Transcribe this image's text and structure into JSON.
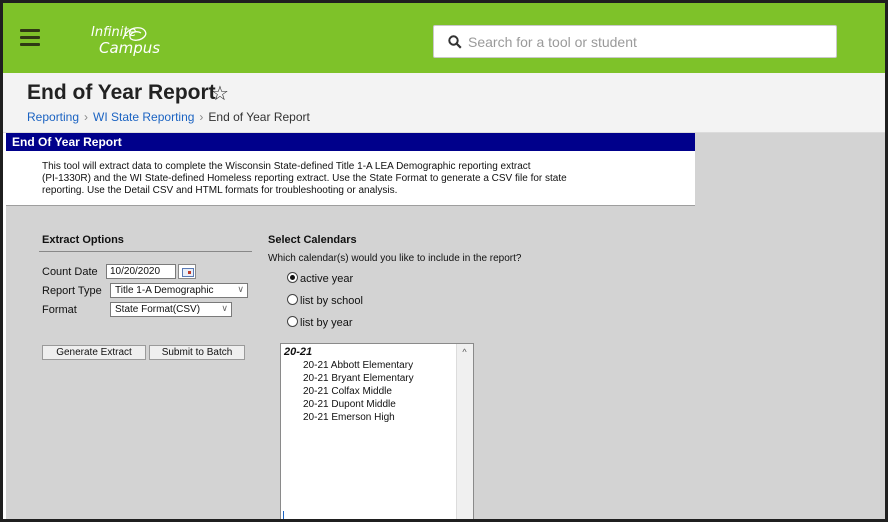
{
  "app": {
    "logo_line1": "Infinite",
    "logo_line2": "Campus",
    "search_placeholder": "Search for a tool or student"
  },
  "header": {
    "title": "End of Year Report",
    "breadcrumb": [
      "Reporting",
      "WI State Reporting",
      "End of Year Report"
    ]
  },
  "panel": {
    "band_title": "End Of Year Report",
    "description_lines": [
      "This tool will extract data to complete the Wisconsin State-defined Title 1-A LEA Demographic reporting extract",
      "(PI-1330R) and the WI State-defined Homeless reporting extract. Use the State Format to generate a CSV file for state",
      "reporting. Use the Detail CSV and HTML formats for troubleshooting or analysis."
    ]
  },
  "extract_options": {
    "heading": "Extract Options",
    "count_date_label": "Count Date",
    "count_date_value": "10/20/2020",
    "report_type_label": "Report Type",
    "report_type_value": "Title 1-A Demographic",
    "format_label": "Format",
    "format_value": "State Format(CSV)",
    "generate_button": "Generate Extract",
    "batch_button": "Submit to Batch"
  },
  "calendars": {
    "heading": "Select Calendars",
    "question": "Which calendar(s) would you like to include in the report?",
    "options": [
      {
        "label": "active year",
        "selected": true
      },
      {
        "label": "list by school",
        "selected": false
      },
      {
        "label": "list by year",
        "selected": false
      }
    ],
    "group": "20-21",
    "items": [
      "20-21 Abbott Elementary",
      "20-21 Bryant Elementary",
      "20-21 Colfax Middle",
      "20-21 Dupont Middle",
      "20-21 Emerson High"
    ]
  },
  "icons": {
    "menu": "hamburger-icon",
    "search": "search-icon",
    "favorite": "star-outline-icon",
    "calendar": "calendar-icon"
  },
  "colors": {
    "topbar": "#7ec229",
    "band": "#00008b",
    "link": "#1b63c2"
  }
}
